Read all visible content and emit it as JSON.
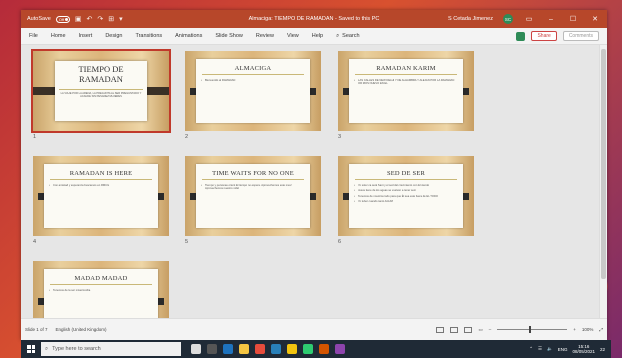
{
  "titlebar": {
    "autosave_label": "AutoSave",
    "autosave_state": "Off",
    "doc_title": "Almaciga: TIEMPO DE RAMADAN - Saved to this PC",
    "user_name": "S Cetada Jimenez",
    "user_initials": "SC",
    "accent": "#b7472a"
  },
  "menu": {
    "items": [
      "File",
      "Home",
      "Insert",
      "Design",
      "Transitions",
      "Animations",
      "Slide Show",
      "Review",
      "View",
      "Help"
    ],
    "search_label": "Search",
    "share_label": "Share",
    "comments_label": "Comments"
  },
  "slides": [
    {
      "num": "1",
      "title": "TIEMPO DE RAMADAN",
      "subtitle": "LA VIAJE POR LA ARENA, LA PREGUNTA AL SER PREGUNTADO Y ACAUDE SIN PESADEZ MUJERES",
      "bullets": []
    },
    {
      "num": "2",
      "title": "ALMACIGA",
      "bullets": [
        "Bienvenido al RAMADAN"
      ]
    },
    {
      "num": "3",
      "title": "RAMADAN KARIM",
      "bullets": [
        "LAS CALLES DE NEW DELHI Y DE ALHAMBRA Y ALEJAN POR LA RAMADAN OR MOS NUEVO EN EL "
      ]
    },
    {
      "num": "4",
      "title": "RAMADAN IS HERE",
      "bullets": [
        "Con amistad y esperanza buscamos en RMCG"
      ]
    },
    {
      "num": "5",
      "title": "TIME WAITS FOR NO ONE",
      "bullets": [
        "Tiempo y personas orient El tiempo no espera. Aprovechemos este mes! Aprovechemos nuestro vida!"
      ]
    },
    {
      "num": "6",
      "title": "SED DE SER",
      "bullets": [
        "Yo soler ca será Sant y el sed del crecimiento con El viendo",
        "Jesus tiene de los aguas se vuelven a tener sed.",
        "Tenemos de nosotros todo para que Él sea este fuera de EL TODO",
        "Yo tuber cuando tanto AGUM"
      ]
    },
    {
      "num": "7",
      "title": "MADAD MADAD",
      "bullets": [
        "Tenemos de la ser misericordia"
      ]
    }
  ],
  "status": {
    "slide_of": "Slide 1 of 7",
    "language": "English (United Kingdom)",
    "zoom": "100%"
  },
  "taskbar": {
    "search_placeholder": "Type here to search",
    "time": "15:16",
    "date": "08/05/2021",
    "lang": "ENG",
    "notif_count": "22"
  }
}
